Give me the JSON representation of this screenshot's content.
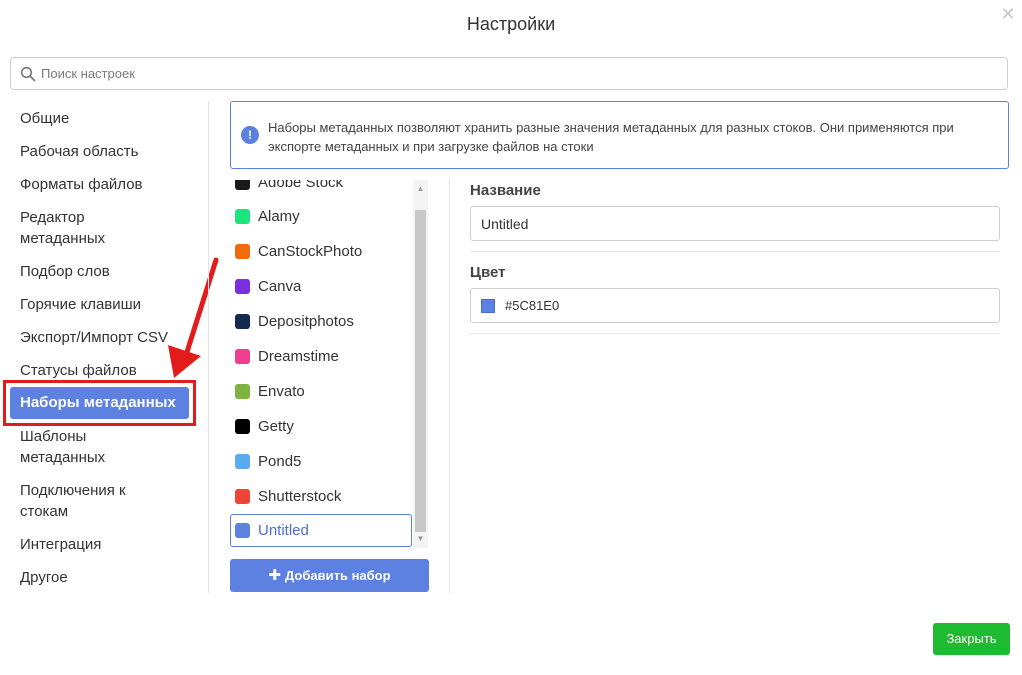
{
  "window": {
    "title": "Настройки"
  },
  "search": {
    "placeholder": "Поиск настроек"
  },
  "sidebar": {
    "items": [
      {
        "label": "Общие"
      },
      {
        "label": "Рабочая область"
      },
      {
        "label": "Форматы файлов"
      },
      {
        "label": "Редактор метаданных"
      },
      {
        "label": "Подбор слов"
      },
      {
        "label": "Горячие клавиши"
      },
      {
        "label": "Экспорт/Импорт CSV"
      },
      {
        "label": "Статусы файлов"
      },
      {
        "label": "Наборы метаданных",
        "active": true
      },
      {
        "label": "Шаблоны метаданных"
      },
      {
        "label": "Подключения к стокам"
      },
      {
        "label": "Интеграция"
      },
      {
        "label": "Другое"
      }
    ]
  },
  "info": {
    "text": "Наборы метаданных позволяют хранить разные значения метаданных для разных стоков. Они применяются при экспорте метаданных и при загрузке файлов на стоки"
  },
  "sets": {
    "items": [
      {
        "label": "Adobe Stock",
        "color": "#1a1a1a"
      },
      {
        "label": "Alamy",
        "color": "#1de47f"
      },
      {
        "label": "CanStockPhoto",
        "color": "#f26a10"
      },
      {
        "label": "Canva",
        "color": "#7a2fe0"
      },
      {
        "label": "Depositphotos",
        "color": "#13294f"
      },
      {
        "label": "Dreamstime",
        "color": "#ef3d8f"
      },
      {
        "label": "Envato",
        "color": "#7fb33f"
      },
      {
        "label": "Getty",
        "color": "#000000"
      },
      {
        "label": "Pond5",
        "color": "#5aacef"
      },
      {
        "label": "Shutterstock",
        "color": "#ef4538"
      },
      {
        "label": "Untitled",
        "color": "#5C81E0",
        "selected": true
      }
    ],
    "add_label": "Добавить набор"
  },
  "editor": {
    "name_label": "Название",
    "name_value": "Untitled",
    "color_label": "Цвет",
    "color_value": "#5C81E0"
  },
  "footer": {
    "close_label": "Закрыть"
  },
  "colors": {
    "accent": "#5c81e0",
    "close_button": "#1dbb2f",
    "annotation": "#e21b1b"
  }
}
